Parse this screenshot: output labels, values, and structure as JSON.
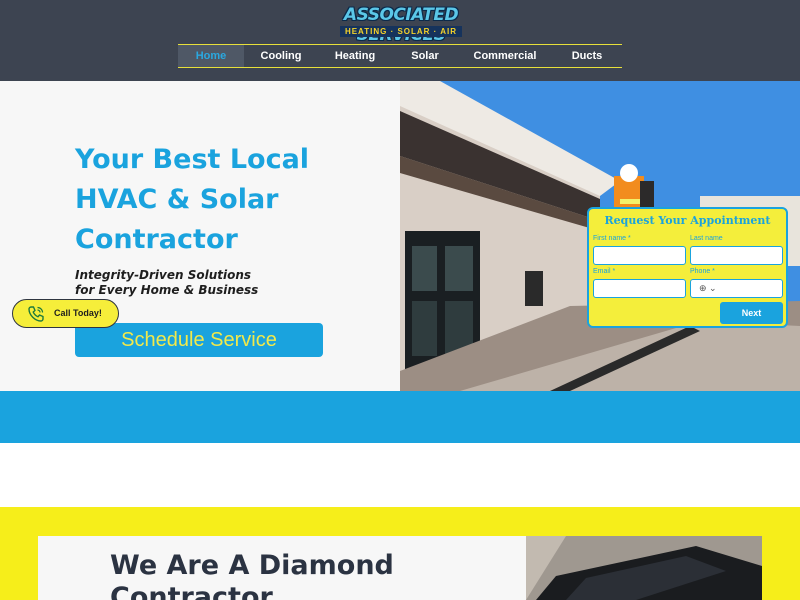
{
  "header": {
    "logo_main": "ASSOCIATED SERVICES",
    "logo_sub": "HEATING · SOLAR · AIR"
  },
  "nav": {
    "items": [
      {
        "label": "Home",
        "active": true
      },
      {
        "label": "Cooling",
        "active": false
      },
      {
        "label": "Heating",
        "active": false
      },
      {
        "label": "Solar",
        "active": false
      },
      {
        "label": "Commercial",
        "active": false
      },
      {
        "label": "Ducts",
        "active": false
      }
    ]
  },
  "hero": {
    "title_line1": "Your Best Local",
    "title_line2": "HVAC & Solar",
    "title_line3": "Contractor",
    "tagline_line1": "Integrity-Driven Solutions",
    "tagline_line2": "for Every Home & Business",
    "schedule_button": "Schedule Service",
    "call_button": "Call Today!"
  },
  "form": {
    "title": "Request Your Appointment",
    "first_name_label": "First name *",
    "last_name_label": "Last name",
    "email_label": "Email *",
    "phone_label": "Phone *",
    "next_button": "Next"
  },
  "about": {
    "title_line1": "We Are A Diamond",
    "title_line2": "Contractor"
  },
  "colors": {
    "header_bg": "#3d4451",
    "brand_blue": "#1aa3de",
    "brand_yellow": "#f6ee1a"
  }
}
